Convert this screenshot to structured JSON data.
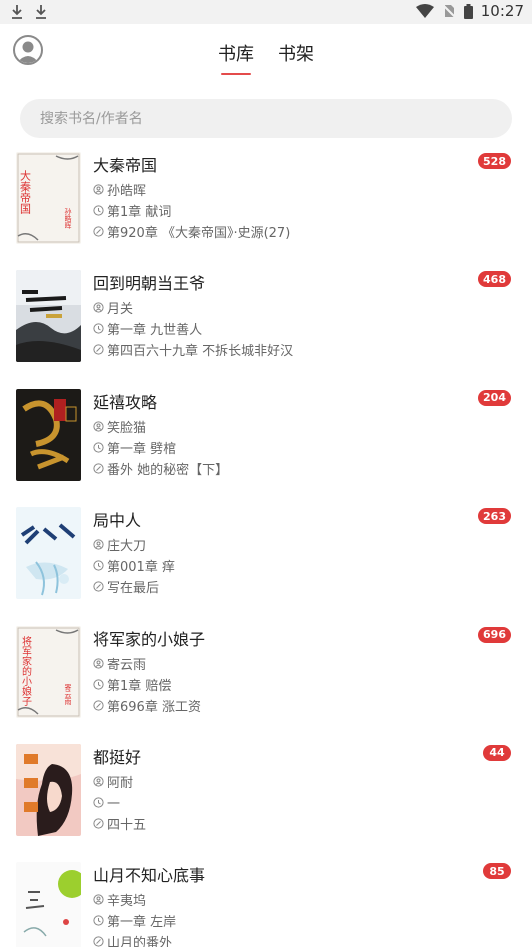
{
  "status_bar": {
    "time": "10:27"
  },
  "header": {
    "tabs": [
      {
        "label": "书库",
        "active": true
      },
      {
        "label": "书架",
        "active": false
      }
    ]
  },
  "search": {
    "placeholder": "搜索书名/作者名"
  },
  "books": [
    {
      "title": "大秦帝国",
      "author": "孙皓晖",
      "first_chapter": "第1章 献词",
      "latest_chapter": "第920章 《大秦帝国》·史源(27)",
      "badge": "528",
      "cover_title": "大秦帝国",
      "cover_author": "孙皓晖"
    },
    {
      "title": "回到明朝当王爷",
      "author": "月关",
      "first_chapter": "第一章 九世善人",
      "latest_chapter": "第四百六十九章 不拆长城非好汉",
      "badge": "468"
    },
    {
      "title": "延禧攻略",
      "author": "笑脸猫",
      "first_chapter": "第一章 劈棺",
      "latest_chapter": "番外 她的秘密【下】",
      "badge": "204"
    },
    {
      "title": "局中人",
      "author": "庄大刀",
      "first_chapter": "第001章 痒",
      "latest_chapter": "写在最后",
      "badge": "263"
    },
    {
      "title": "将军家的小娘子",
      "author": "寄云雨",
      "first_chapter": "第1章 赔偿",
      "latest_chapter": "第696章 涨工资",
      "badge": "696",
      "cover_title": "将军家的小娘子",
      "cover_author": "寄云雨"
    },
    {
      "title": "都挺好",
      "author": "阿耐",
      "first_chapter": "一",
      "latest_chapter": "四十五",
      "badge": "44"
    },
    {
      "title": "山月不知心底事",
      "author": "辛夷坞",
      "first_chapter": "第一章 左岸",
      "latest_chapter": "山月的番外",
      "badge": "85"
    }
  ],
  "colors": {
    "accent": "#e44b4b",
    "badge": "#e03a3a"
  }
}
